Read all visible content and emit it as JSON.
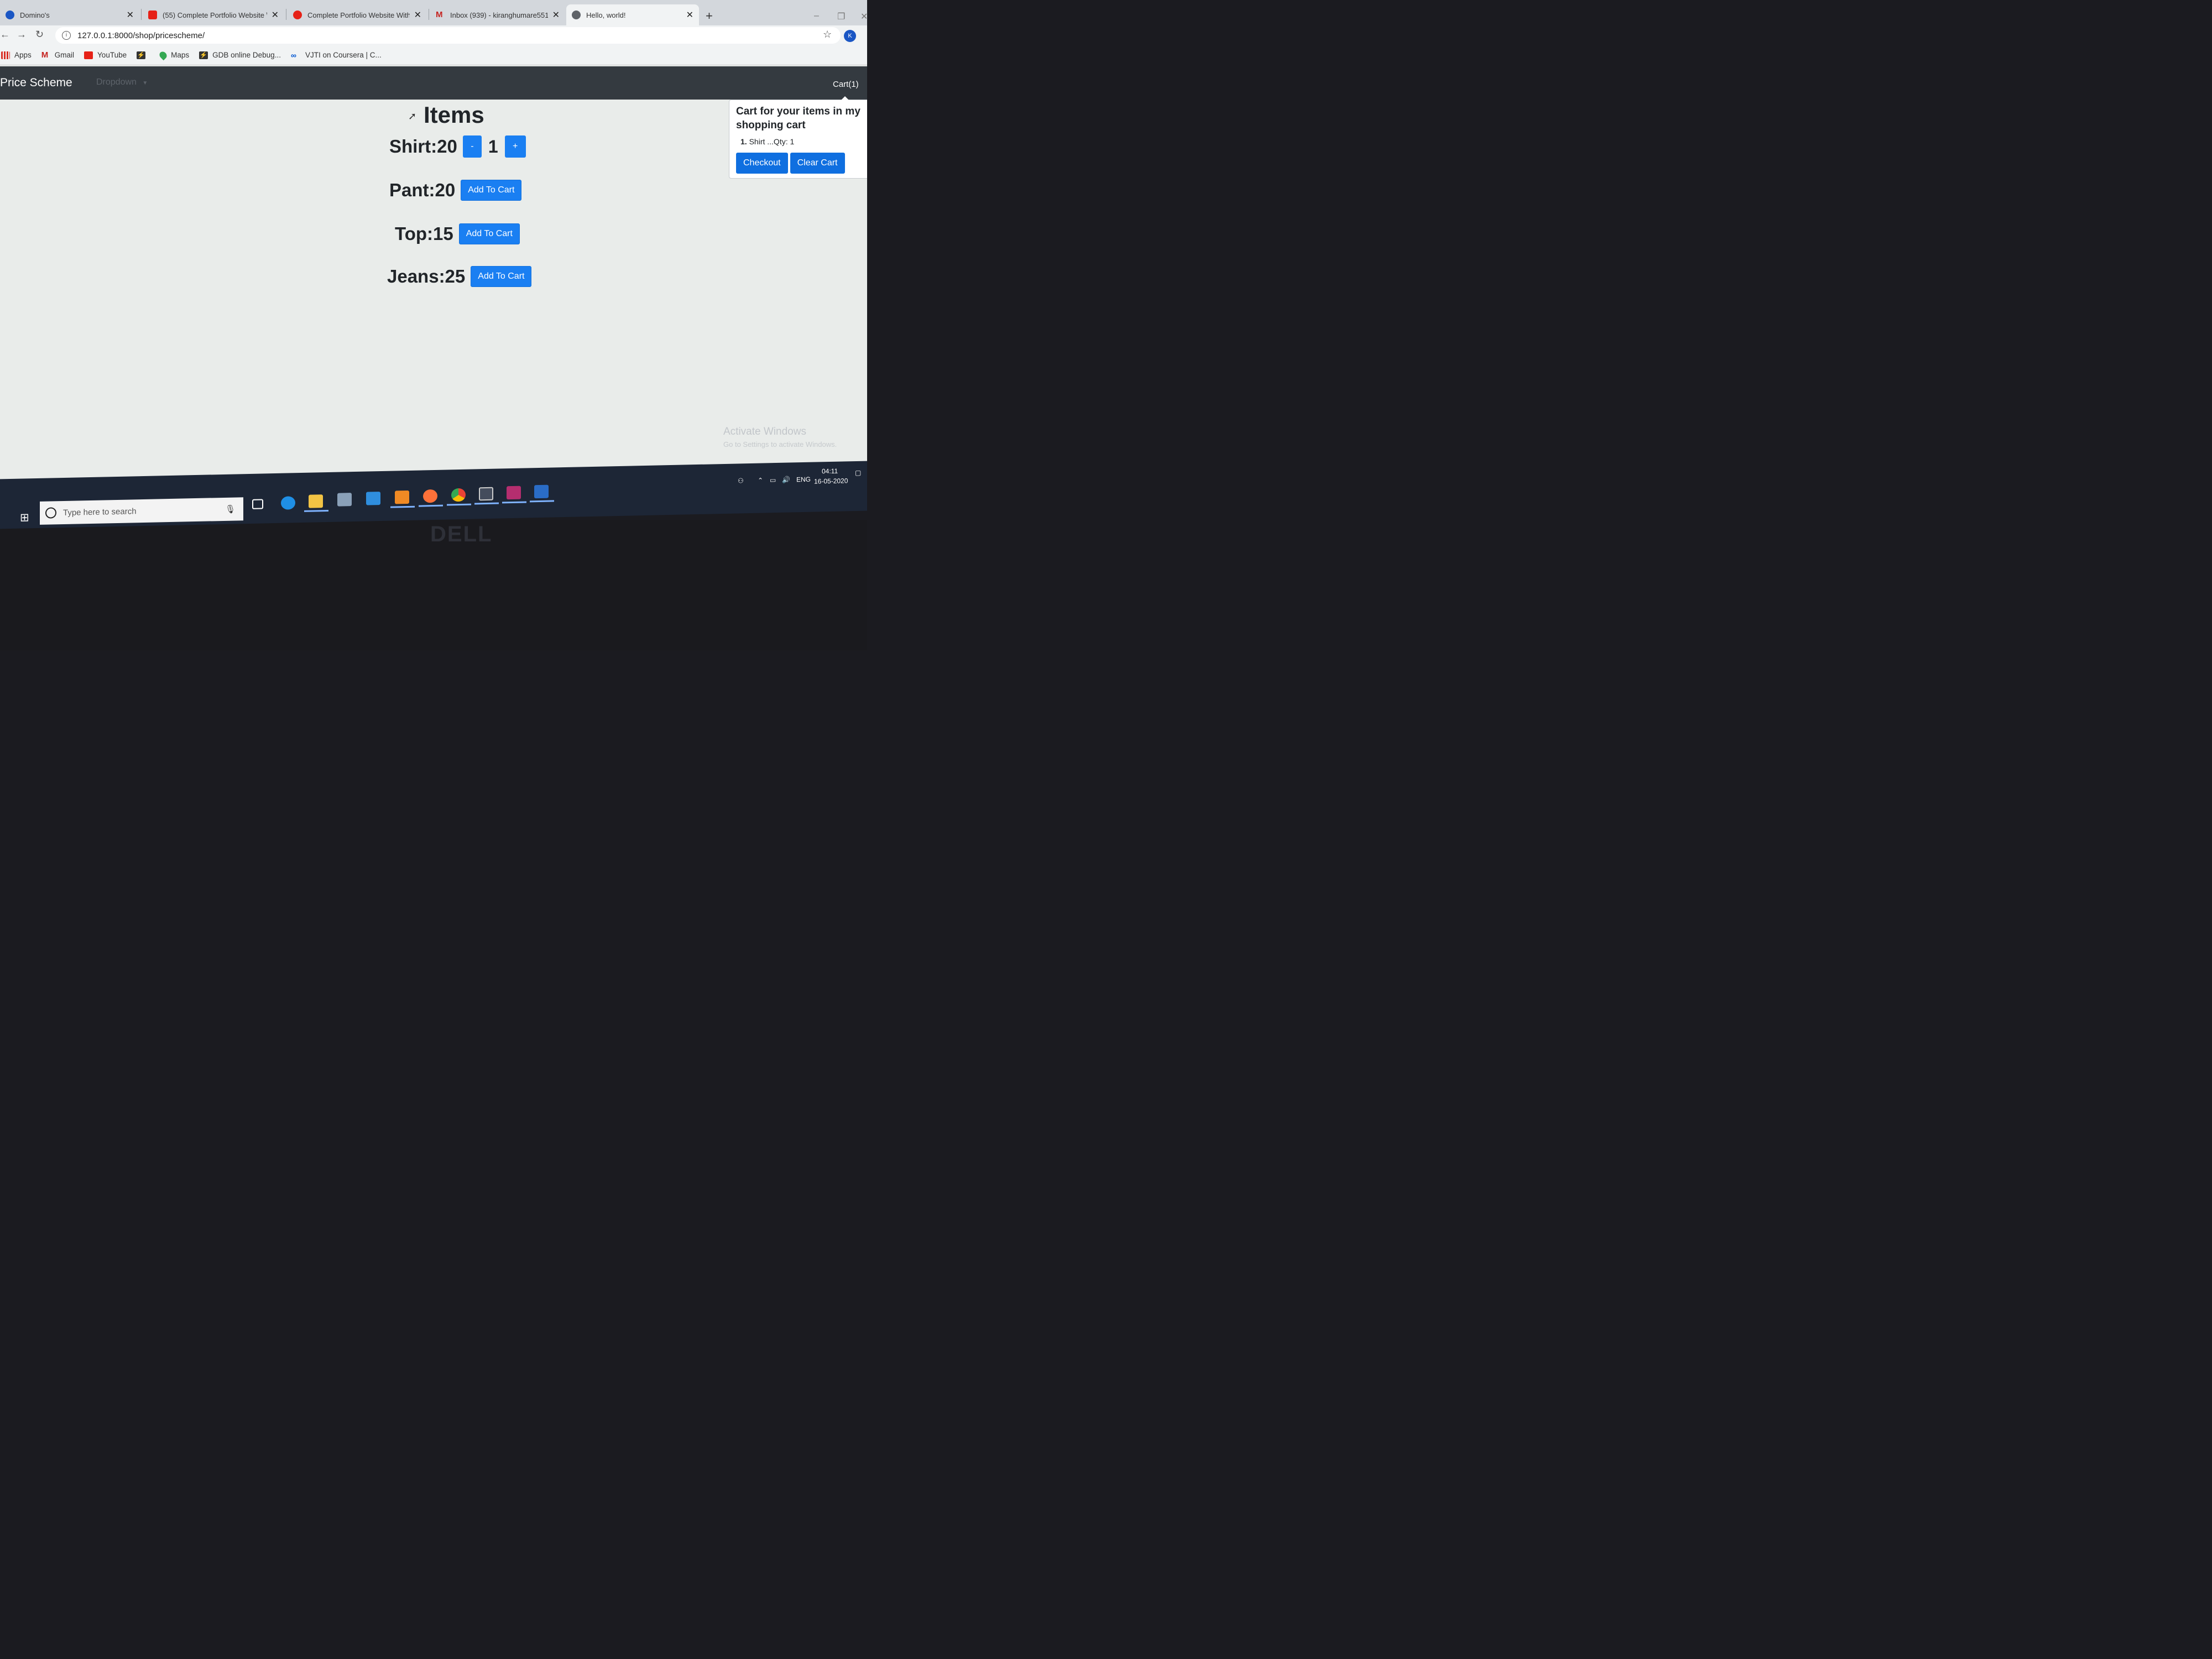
{
  "browser": {
    "tabs": [
      {
        "title": "Domino's",
        "favicon_color": "#1a56c4"
      },
      {
        "title": "(55) Complete Portfolio Website \\",
        "favicon_color": "#e62117"
      },
      {
        "title": "Complete Portfolio Website With",
        "favicon_color": "#e62117"
      },
      {
        "title": "Inbox (939) - kiranghumare5517(",
        "favicon_color": "#c5221f"
      },
      {
        "title": "Hello, world!",
        "favicon_color": "#5f6368"
      }
    ],
    "new_tab": "+",
    "close_glyph": "✕",
    "url": "127.0.0.1:8000/shop/pricescheme/",
    "profile_initial": "K",
    "bookmarks": [
      {
        "label": "Apps",
        "icon": "apps-grid-icon",
        "color": "#d93025"
      },
      {
        "label": "Gmail",
        "icon": "gmail-icon",
        "color": "#c5221f"
      },
      {
        "label": "YouTube",
        "icon": "youtube-icon",
        "color": "#e62117"
      },
      {
        "label": "",
        "icon": "lightning-icon",
        "color": "#333333"
      },
      {
        "label": "Maps",
        "icon": "maps-pin-icon",
        "color": "#34a853"
      },
      {
        "label": "GDB online Debug...",
        "icon": "lightning-icon",
        "color": "#333333"
      },
      {
        "label": "VJTI on Coursera | C...",
        "icon": "coursera-icon",
        "color": "#0056d2"
      }
    ]
  },
  "site": {
    "brand": "Price Scheme",
    "dropdown": "Dropdown",
    "cart_link": "Cart(1)",
    "heading": "Items",
    "shirt": {
      "label": "Shirt:20",
      "minus": "-",
      "qty": "1",
      "plus": "+"
    },
    "products": [
      {
        "label": "Pant:20",
        "button": "Add To Cart"
      },
      {
        "label": "Top:15",
        "button": "Add To Cart"
      },
      {
        "label": "Jeans:25",
        "button": "Add To Cart"
      }
    ],
    "popover": {
      "title": "Cart for your items in my shopping cart",
      "item_number": "1.",
      "item_text": "Shirt ...Qty: 1",
      "checkout": "Checkout",
      "clear": "Clear Cart"
    }
  },
  "watermark": {
    "line1": "Activate Windows",
    "line2": "Go to Settings to activate Windows."
  },
  "taskbar": {
    "search_placeholder": "Type here to search",
    "lang": "ENG",
    "time": "04:11",
    "date": "16-05-2020",
    "apps": [
      {
        "name": "task-view-icon",
        "color": "#ffffff"
      },
      {
        "name": "edge-icon",
        "color": "#1f8fe5"
      },
      {
        "name": "file-explorer-icon",
        "color": "#f3c444"
      },
      {
        "name": "store-icon",
        "color": "#8aa0b8"
      },
      {
        "name": "mail-icon",
        "color": "#2f8ede"
      },
      {
        "name": "sublime-icon",
        "color": "#f08a24"
      },
      {
        "name": "firefox-icon",
        "color": "#ff7139"
      },
      {
        "name": "chrome-icon",
        "color": "#34a853"
      },
      {
        "name": "terminal-icon",
        "color": "#444c5c"
      },
      {
        "name": "winrar-icon",
        "color": "#b52e6f"
      },
      {
        "name": "powershell-icon",
        "color": "#2a6cc6"
      }
    ]
  },
  "laptop": {
    "brand": "DELL"
  }
}
